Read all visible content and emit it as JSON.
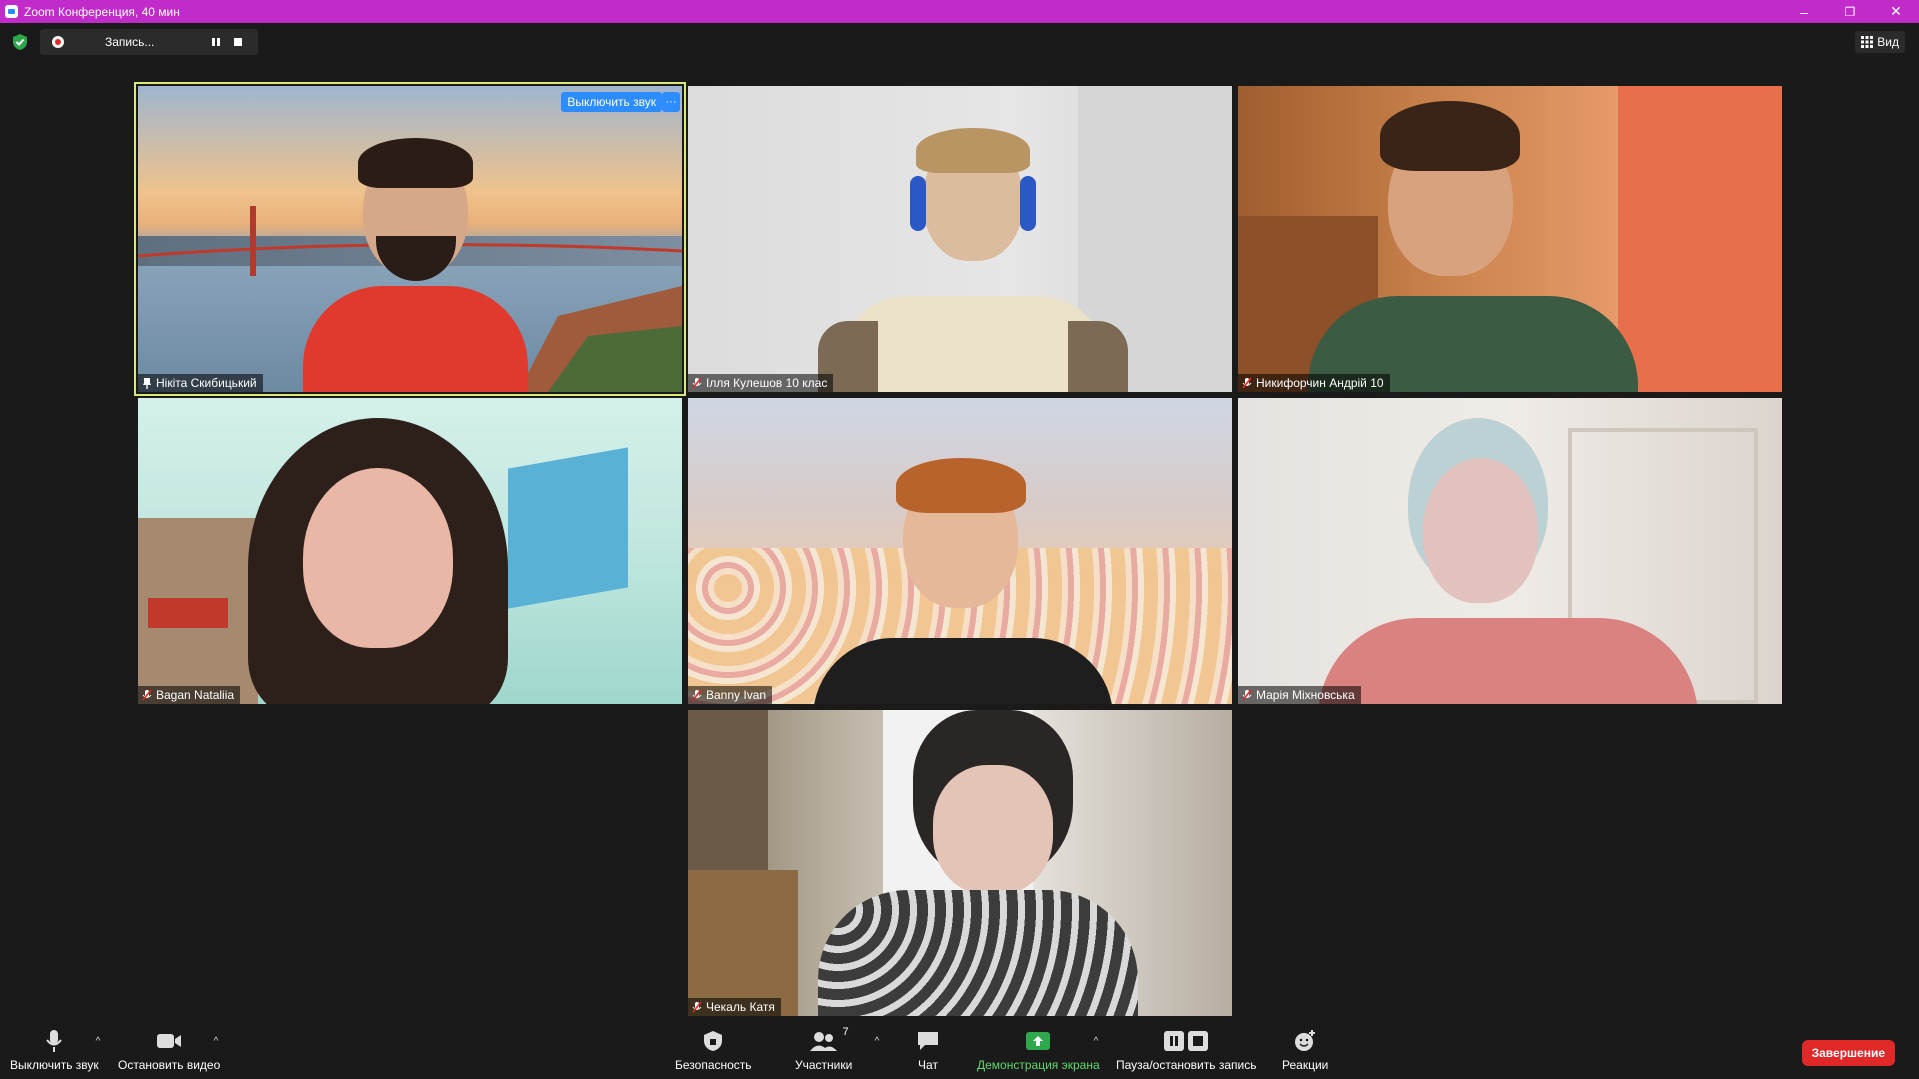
{
  "window": {
    "title": "Zoom Конференция, 40 мин",
    "controls": {
      "minimize": "–",
      "restore": "❐",
      "close": "✕"
    }
  },
  "topbar": {
    "recording_label": "Запись...",
    "view_label": "Вид"
  },
  "tiles": [
    {
      "name": "Нікіта Скибицький",
      "icon": "pin-icon"
    },
    {
      "name": "Ілля Кулешов 10 клас",
      "icon": "muted-mic-icon"
    },
    {
      "name": "Никифорчин Андрій 10",
      "icon": "muted-mic-icon"
    },
    {
      "name": "Bagan Nataliia",
      "icon": "muted-mic-icon"
    },
    {
      "name": "Banny Ivan",
      "icon": "muted-mic-icon"
    },
    {
      "name": "Марія Міхновська",
      "icon": "muted-mic-icon"
    },
    {
      "name": "Чекаль Катя",
      "icon": "muted-mic-icon"
    }
  ],
  "active_speaker": {
    "mute_button": "Выключить звук",
    "more_button": "···"
  },
  "toolbar": {
    "mute": "Выключить звук",
    "video": "Остановить видео",
    "security": "Безопасность",
    "participants": "Участники",
    "participants_count": "7",
    "chat": "Чат",
    "share": "Демонстрация экрана",
    "record": "Пауза/остановить запись",
    "reactions": "Реакции",
    "end": "Завершение"
  },
  "colors": {
    "titlebar": "#c02bc9",
    "accent": "#2d8cff",
    "active_border": "#d8e87a",
    "share_green": "#5ed86c",
    "end_red": "#e02828"
  }
}
